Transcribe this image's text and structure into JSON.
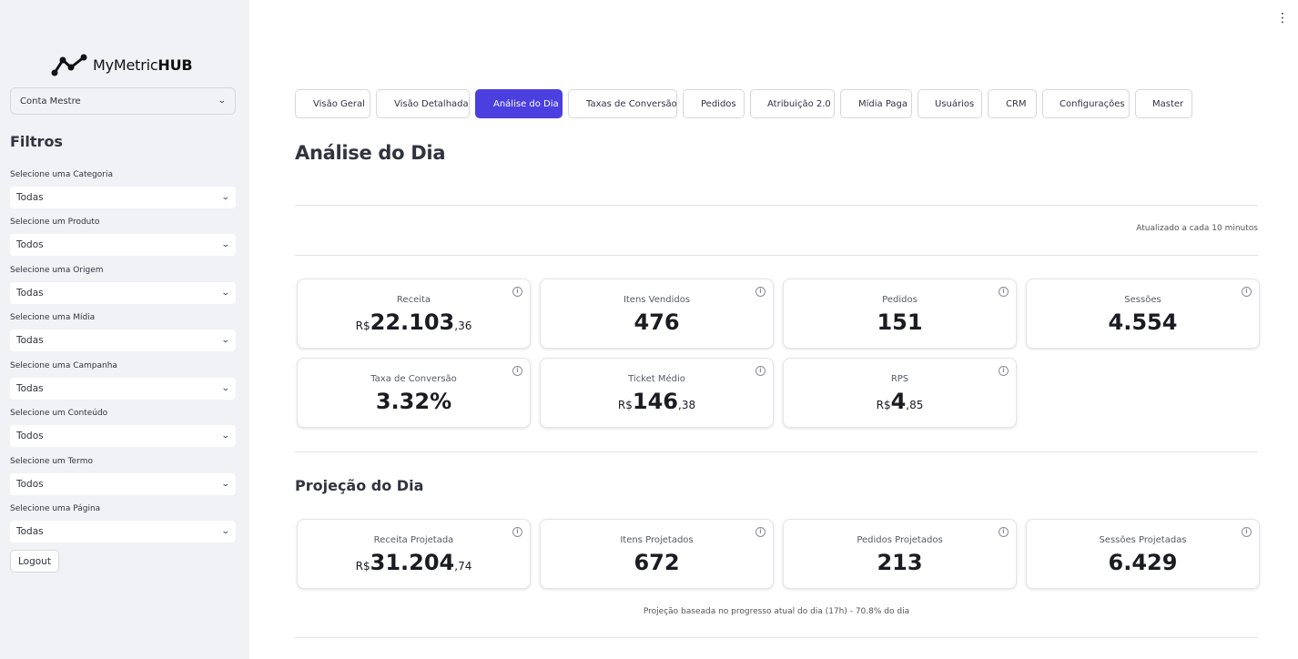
{
  "brand": {
    "name_regular": "MyMetric",
    "name_bold": "HUB",
    "logo_icon": "chart-line-icon"
  },
  "account": {
    "selected": "Conta Mestre"
  },
  "filters": {
    "title": "Filtros",
    "items": [
      {
        "label": "Selecione uma Categoria",
        "value": "Todas"
      },
      {
        "label": "Selecione um Produto",
        "value": "Todos"
      },
      {
        "label": "Selecione uma Origem",
        "value": "Todas"
      },
      {
        "label": "Selecione uma Mídia",
        "value": "Todas"
      },
      {
        "label": "Selecione uma Campanha",
        "value": "Todas"
      },
      {
        "label": "Selecione um Conteúdo",
        "value": "Todos"
      },
      {
        "label": "Selecione um Termo",
        "value": "Todos"
      },
      {
        "label": "Selecione uma Página",
        "value": "Todas"
      }
    ]
  },
  "logout_label": "Logout",
  "tabs": [
    {
      "label": "Visão Geral",
      "active": false
    },
    {
      "label": "Visão Detalhada",
      "active": false
    },
    {
      "label": "Análise do Dia",
      "active": true
    },
    {
      "label": "Taxas de Conversão",
      "active": false
    },
    {
      "label": "Pedidos",
      "active": false
    },
    {
      "label": "Atribuição 2.0",
      "active": false
    },
    {
      "label": "Mídia Paga",
      "active": false
    },
    {
      "label": "Usuários",
      "active": false
    },
    {
      "label": "CRM",
      "active": false
    },
    {
      "label": "Configurações",
      "active": false
    },
    {
      "label": "Master",
      "active": false
    }
  ],
  "page_title": "Análise do Dia",
  "updated_note": "Atualizado a cada 10 minutos",
  "metrics": [
    {
      "label": "Receita",
      "currency": "R$",
      "value": "22.103",
      "cents": ",36"
    },
    {
      "label": "Itens Vendidos",
      "value": "476"
    },
    {
      "label": "Pedidos",
      "value": "151"
    },
    {
      "label": "Sessões",
      "value": "4.554"
    },
    {
      "label": "Taxa de Conversão",
      "value": "3.32%"
    },
    {
      "label": "Ticket Médio",
      "currency": "R$",
      "value": "146",
      "cents": ",38"
    },
    {
      "label": "RPS",
      "currency": "R$",
      "value": "4",
      "cents": ",85"
    }
  ],
  "projection": {
    "title": "Projeção do Dia",
    "metrics": [
      {
        "label": "Receita Projetada",
        "currency": "R$",
        "value": "31.204",
        "cents": ",74"
      },
      {
        "label": "Itens Projetados",
        "value": "672"
      },
      {
        "label": "Pedidos Projetados",
        "value": "213"
      },
      {
        "label": "Sessões Projetadas",
        "value": "6.429"
      }
    ],
    "note": "Projeção baseada no progresso atual do dia (17h) - 70.8% do dia"
  },
  "colors": {
    "accent": "#4b3fe0",
    "sidebar_bg": "#f0f2f6"
  }
}
